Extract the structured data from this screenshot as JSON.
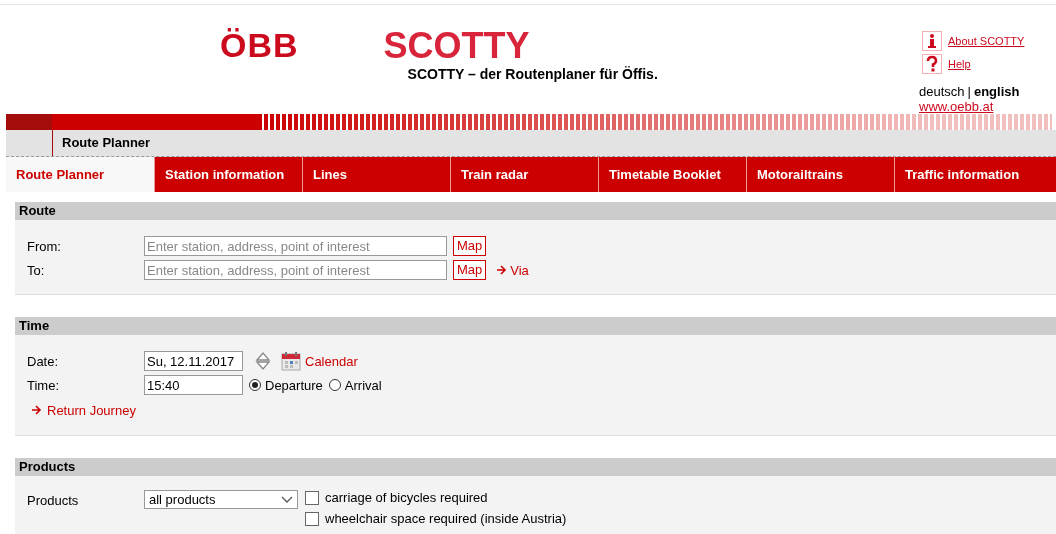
{
  "header": {
    "logo": "ÖBB",
    "brand": "SCOTTY",
    "tagline": "SCOTTY – der Routenplaner für Öffis.",
    "links": [
      {
        "kind": "info",
        "label": "About SCOTTY"
      },
      {
        "kind": "help",
        "label": "Help"
      }
    ],
    "languages": [
      {
        "label": "deutsch",
        "selected": false
      },
      {
        "label": "english",
        "selected": true
      }
    ],
    "language_separator": "|",
    "website": "www.oebb.at"
  },
  "breadcrumb": "Route Planner",
  "tabs": [
    {
      "label": "Route Planner",
      "selected": true
    },
    {
      "label": "Station information",
      "selected": false
    },
    {
      "label": "Lines",
      "selected": false
    },
    {
      "label": "Train radar",
      "selected": false
    },
    {
      "label": "Timetable Booklet",
      "selected": false
    },
    {
      "label": "Motorailtrains",
      "selected": false
    },
    {
      "label": "Traffic information",
      "selected": false
    }
  ],
  "route": {
    "title": "Route",
    "fields": [
      {
        "label": "From:",
        "placeholder": "Enter station, address, point of interest",
        "map": "Map"
      },
      {
        "label": "To:",
        "placeholder": "Enter station, address, point of interest",
        "map": "Map",
        "via": "Via"
      }
    ]
  },
  "time": {
    "title": "Time",
    "date_label": "Date:",
    "date": "Su, 12.11.2017",
    "calendar": "Calendar",
    "time_label": "Time:",
    "time": "15:40",
    "modes": [
      {
        "label": "Departure",
        "selected": true
      },
      {
        "label": "Arrival",
        "selected": false
      }
    ],
    "return_journey": "Return Journey"
  },
  "products": {
    "title": "Products",
    "label": "Products",
    "value": "all products",
    "options": [
      {
        "label": "carriage of bicycles required",
        "checked": false
      },
      {
        "label": "wheelchair space required (inside Austria)",
        "checked": false
      }
    ]
  }
}
